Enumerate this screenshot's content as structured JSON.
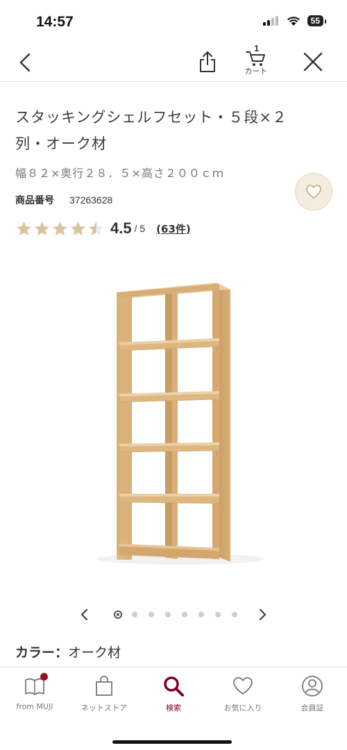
{
  "status_bar": {
    "time": "14:57",
    "battery": "55",
    "signal_icon": "cellular-signal-icon",
    "wifi_icon": "wifi-icon"
  },
  "nav": {
    "back_icon": "chevron-left-icon",
    "share_icon": "share-icon",
    "cart_count": "1",
    "cart_label": "カート",
    "close_icon": "close-icon"
  },
  "product": {
    "title": "スタッキングシェルフセット・５段×２列・オーク材",
    "size": "幅８２×奥行２８．５×高さ２００ｃｍ",
    "code_label": "商品番号",
    "code_value": "37263628",
    "favorite_icon": "heart-icon",
    "rating": {
      "stars": 4.5,
      "value": "4.5",
      "max": "/ 5",
      "review_count": "(63件)"
    },
    "color_label": "カラー：",
    "color_value": "オーク材"
  },
  "carousel": {
    "total": 8,
    "active_index": 0
  },
  "tabs": [
    {
      "label": "from MUJI",
      "icon": "book-icon",
      "active": false,
      "badge": true
    },
    {
      "label": "ネットストア",
      "icon": "shopping-bag-icon",
      "active": false,
      "badge": false
    },
    {
      "label": "検索",
      "icon": "search-icon",
      "active": true,
      "badge": false
    },
    {
      "label": "お気に入り",
      "icon": "heart-icon",
      "active": false,
      "badge": false
    },
    {
      "label": "会員証",
      "icon": "member-icon",
      "active": false,
      "badge": false
    }
  ],
  "colors": {
    "accent": "#7f0019",
    "star": "#d8c49e",
    "favorite_bg": "#f5ece0",
    "wood": "#d9b07a"
  }
}
